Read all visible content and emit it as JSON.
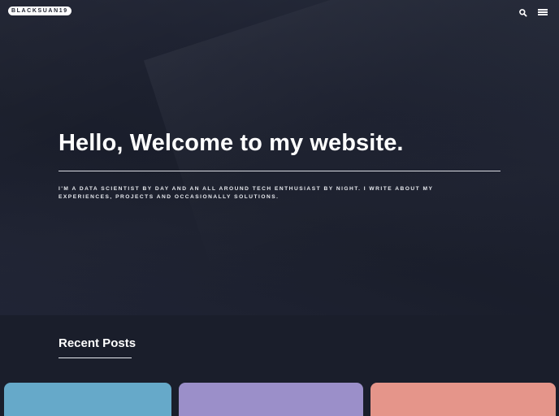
{
  "header": {
    "logo_text": "BLACKSUAN19",
    "icons": [
      "search-icon",
      "menu-icon"
    ]
  },
  "hero": {
    "title": "Hello, Welcome to my website.",
    "description": "I'm a data scientist by day and an all around tech enthusiast by night. I write about my experiences, projects and occasionally solutions."
  },
  "recent_posts": {
    "heading": "Recent Posts",
    "cards": [
      {
        "color": "#66a9c9"
      },
      {
        "color": "#9b8fc9"
      },
      {
        "color": "#e5958a"
      }
    ]
  },
  "colors": {
    "background": "#1a1e2b",
    "text": "#ffffff"
  }
}
